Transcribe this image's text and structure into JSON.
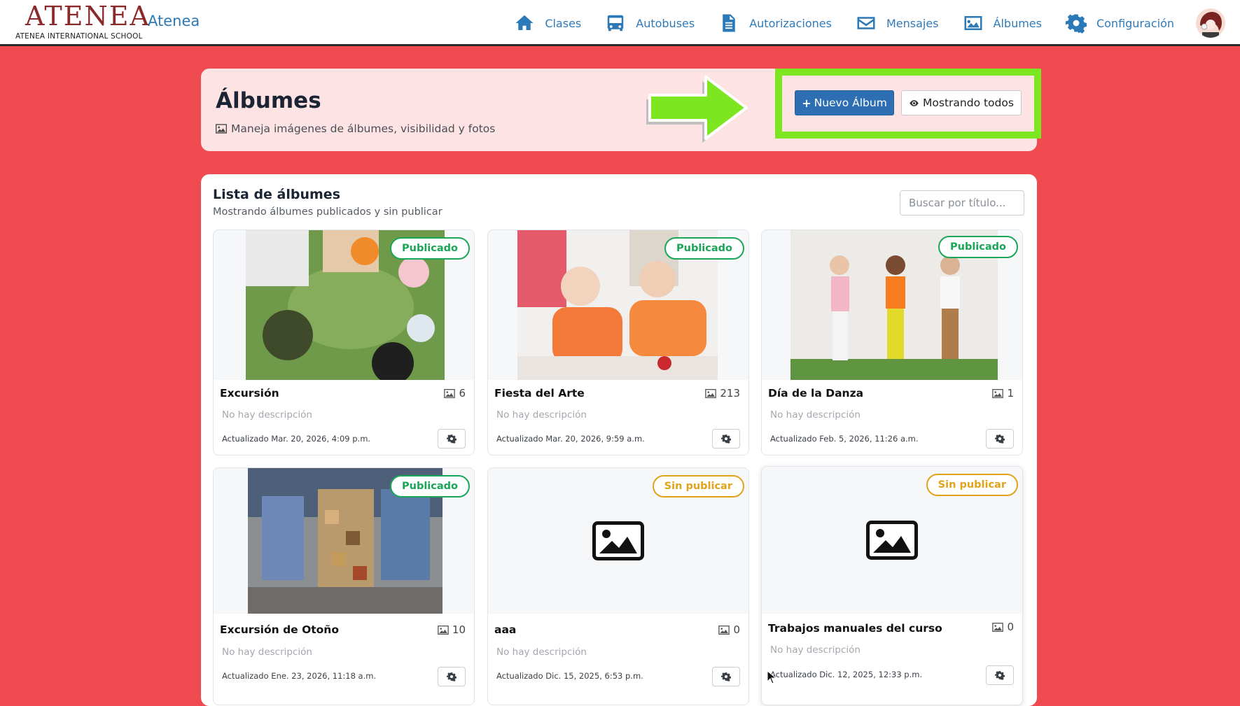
{
  "brand": {
    "logo_word": "ATENEA",
    "logo_sub": "ATENEA INTERNATIONAL SCHOOL",
    "app_name": "Atenea"
  },
  "nav": {
    "items": [
      {
        "label": "Clases",
        "icon": "home-icon"
      },
      {
        "label": "Autobuses",
        "icon": "bus-icon"
      },
      {
        "label": "Autorizaciones",
        "icon": "document-icon"
      },
      {
        "label": "Mensajes",
        "icon": "envelope-icon"
      },
      {
        "label": "Álbumes",
        "icon": "image-icon"
      },
      {
        "label": "Configuración",
        "icon": "gear-icon"
      }
    ]
  },
  "header": {
    "title": "Álbumes",
    "subtitle": "Maneja imágenes de álbumes, visibilidad y fotos",
    "new_album_label": "Nuevo Álbum",
    "show_all_label": "Mostrando todos"
  },
  "list": {
    "title": "Lista de álbumes",
    "subtitle": "Mostrando álbumes publicados y sin publicar",
    "search_placeholder": "Buscar por título..."
  },
  "albums": [
    {
      "title": "Excursión",
      "count": "6",
      "status": "Publicado",
      "description": "No hay descripción",
      "updated": "Actualizado Mar. 20, 2026, 4:09 p.m."
    },
    {
      "title": "Fiesta del Arte",
      "count": "213",
      "status": "Publicado",
      "description": "No hay descripción",
      "updated": "Actualizado Mar. 20, 2026, 9:59 a.m."
    },
    {
      "title": "Día de la Danza",
      "count": "1",
      "status": "Publicado",
      "description": "No hay descripción",
      "updated": "Actualizado Feb. 5, 2026, 11:26 a.m."
    },
    {
      "title": "Excursión de Otoño",
      "count": "10",
      "status": "Publicado",
      "description": "No hay descripción",
      "updated": "Actualizado Ene. 23, 2026, 11:18 a.m."
    },
    {
      "title": "aaa",
      "count": "0",
      "status": "Sin publicar",
      "description": "No hay descripción",
      "updated": "Actualizado Dic. 15, 2025, 6:53 p.m."
    },
    {
      "title": "Trabajos manuales del curso",
      "count": "0",
      "status": "Sin publicar",
      "description": "No hay descripción",
      "updated": "Actualizado Dic. 12, 2025, 12:33 p.m."
    }
  ],
  "colors": {
    "background": "#ef4a4f",
    "primary": "#2e6eb3",
    "published": "#1aa657",
    "unpublished": "#e2a31a",
    "highlight": "#7ce620"
  }
}
